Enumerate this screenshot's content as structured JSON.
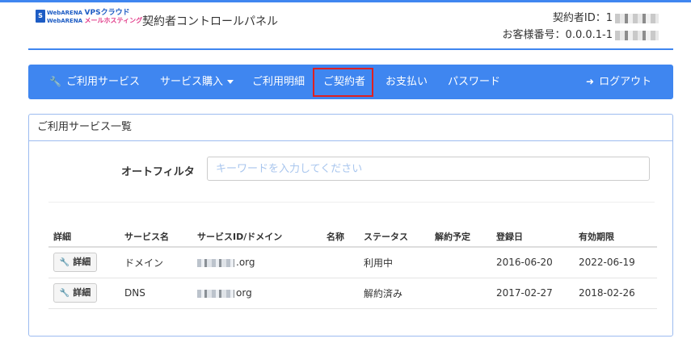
{
  "brand": {
    "line1_prefix": "WebARENA",
    "line1_name": "VPSクラウド",
    "line2_prefix": "WebARENA",
    "line2_name": "メールホスティング",
    "badge": "S"
  },
  "header": {
    "title": "契約者コントロールパネル",
    "contract_id_label": "契約者ID：1",
    "customer_number_label": "お客様番号：0.0.0.1-1"
  },
  "nav": {
    "items": [
      {
        "label": "ご利用サービス",
        "icon": "wrench-icon",
        "glyph": "🔧"
      },
      {
        "label": "サービス購入",
        "dropdown": true
      },
      {
        "label": "ご利用明細"
      },
      {
        "label": "ご契約者",
        "highlighted": true
      },
      {
        "label": "お支払い"
      },
      {
        "label": "パスワード"
      }
    ],
    "logout": {
      "label": "ログアウト",
      "icon": "logout-icon",
      "glyph": "➜"
    }
  },
  "panel": {
    "title": "ご利用サービス一覧",
    "filter_label": "オートフィルタ",
    "filter_placeholder": "キーワードを入力してください",
    "filter_value": ""
  },
  "table": {
    "columns": [
      "詳細",
      "サービス名",
      "サービスID/ドメイン",
      "名称",
      "ステータス",
      "解約予定",
      "登録日",
      "有効期限"
    ],
    "rows": [
      {
        "detail": "詳細",
        "service": "ドメイン",
        "domain_suffix": ".org",
        "name": "",
        "status": "利用中",
        "cancel": "",
        "registered": "2016-06-20",
        "expires": "2022-06-19"
      },
      {
        "detail": "詳細",
        "service": "DNS",
        "domain_suffix": "org",
        "name": "",
        "status": "解約済み",
        "cancel": "",
        "registered": "2017-02-27",
        "expires": "2018-02-26"
      }
    ]
  },
  "colors": {
    "accent": "#3f86f0",
    "highlight_border": "#e02020",
    "panel_border": "#9dbcf0"
  }
}
